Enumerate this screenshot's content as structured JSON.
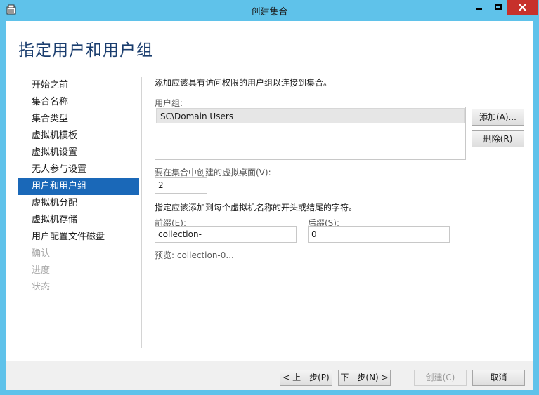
{
  "window": {
    "title": "创建集合"
  },
  "page": {
    "title": "指定用户和用户组"
  },
  "nav": {
    "items": [
      {
        "label": "开始之前",
        "state": "normal"
      },
      {
        "label": "集合名称",
        "state": "normal"
      },
      {
        "label": "集合类型",
        "state": "normal"
      },
      {
        "label": "虚拟机模板",
        "state": "normal"
      },
      {
        "label": "虚拟机设置",
        "state": "normal"
      },
      {
        "label": "无人参与设置",
        "state": "normal"
      },
      {
        "label": "用户和用户组",
        "state": "active"
      },
      {
        "label": "虚拟机分配",
        "state": "normal"
      },
      {
        "label": "虚拟机存储",
        "state": "normal"
      },
      {
        "label": "用户配置文件磁盘",
        "state": "normal"
      },
      {
        "label": "确认",
        "state": "disabled"
      },
      {
        "label": "进度",
        "state": "disabled"
      },
      {
        "label": "状态",
        "state": "disabled"
      }
    ]
  },
  "content": {
    "instruction": "添加应该具有访问权限的用户组以连接到集合。",
    "groups_label": "用户组:",
    "groups": [
      "SC\\Domain Users"
    ],
    "add_button": "添加(A)...",
    "remove_button": "删除(R)",
    "desktops_label": "要在集合中创建的虚拟桌面(V):",
    "desktops_value": "2",
    "naming_instruction": "指定应该添加到每个虚拟机名称的开头或结尾的字符。",
    "prefix_label": "前缀(E):",
    "prefix_value": "collection-",
    "suffix_label": "后缀(S):",
    "suffix_value": "0",
    "preview": "预览: collection-0..."
  },
  "footer": {
    "previous": "< 上一步(P)",
    "next": "下一步(N) >",
    "create": "创建(C)",
    "cancel": "取消"
  },
  "icons": {
    "app": "server-manager-icon",
    "minimize": "minimize-icon",
    "maximize": "maximize-icon",
    "close": "close-icon"
  },
  "colors": {
    "titlebar": "#5fc2ea",
    "close": "#c7312b",
    "selection": "#1a68b8",
    "title_text": "#1a3d6e"
  }
}
